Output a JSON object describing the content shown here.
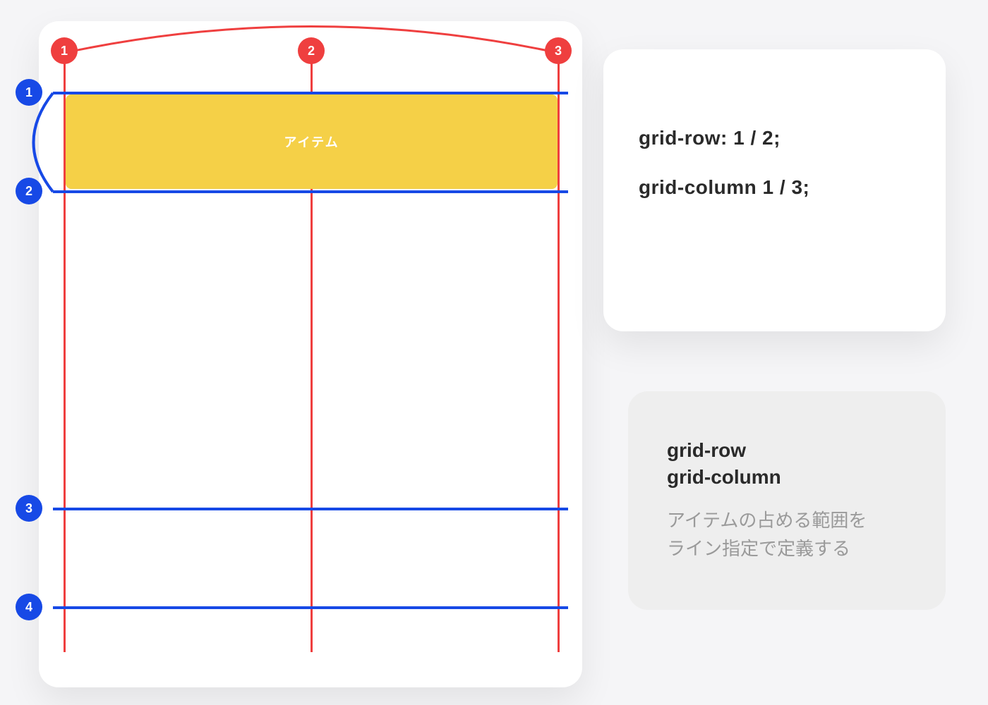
{
  "diagram": {
    "item_label": "アイテム",
    "column_markers": [
      "1",
      "2",
      "3"
    ],
    "row_markers": [
      "1",
      "2",
      "3",
      "4"
    ]
  },
  "code": {
    "line1": "grid-row: 1 / 2;",
    "line2": "grid-column 1 / 3;"
  },
  "info": {
    "title_line1": "grid-row",
    "title_line2": "grid-column",
    "desc_line1": "アイテムの占める範囲を",
    "desc_line2": "ライン指定で定義する"
  },
  "colors": {
    "red": "#ef3f3f",
    "blue": "#1749e6",
    "yellow": "#f5d047"
  }
}
